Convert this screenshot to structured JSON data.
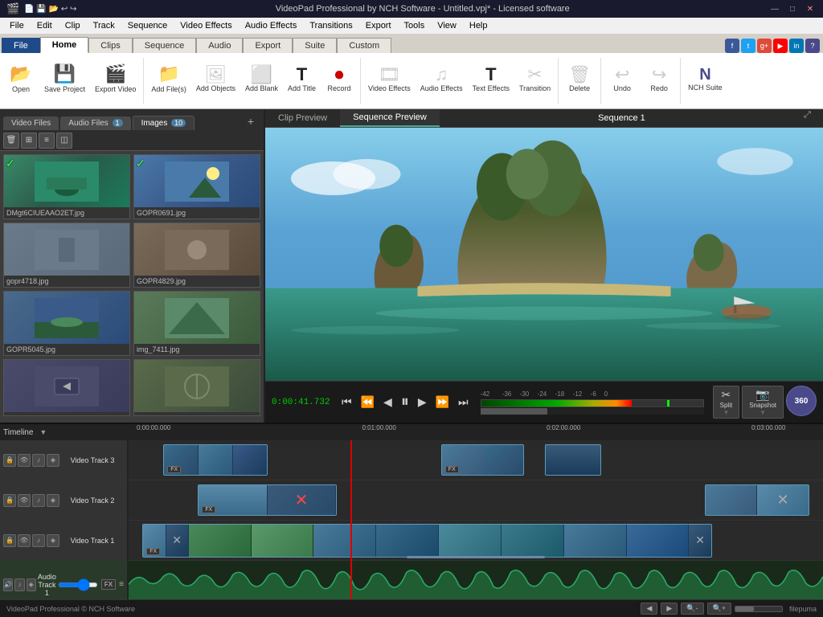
{
  "titlebar": {
    "title": "VideoPad Professional by NCH Software - Untitled.vpj* - Licensed software",
    "min": "—",
    "max": "□",
    "close": "✕"
  },
  "menubar": {
    "items": [
      "File",
      "Edit",
      "Clip",
      "Track",
      "Sequence",
      "Video Effects",
      "Audio Effects",
      "Transitions",
      "Export",
      "Tools",
      "View",
      "Help"
    ]
  },
  "ribbon_tabs": {
    "tabs": [
      "File",
      "Home",
      "Clips",
      "Sequence",
      "Audio",
      "Export",
      "Suite",
      "Custom"
    ]
  },
  "ribbon": {
    "buttons": [
      {
        "icon": "📂",
        "label": "Open"
      },
      {
        "icon": "💾",
        "label": "Save Project"
      },
      {
        "icon": "🎬",
        "label": "Export Video"
      },
      {
        "icon": "📁",
        "label": "Add File(s)"
      },
      {
        "icon": "➕",
        "label": "Add Objects"
      },
      {
        "icon": "⬜",
        "label": "Add Blank"
      },
      {
        "icon": "T",
        "label": "Add Title"
      },
      {
        "icon": "⏺",
        "label": "Record"
      },
      {
        "icon": "🎞",
        "label": "Video Effects"
      },
      {
        "icon": "♪",
        "label": "Audio Effects"
      },
      {
        "icon": "T",
        "label": "Text Effects"
      },
      {
        "icon": "✂",
        "label": "Transition"
      },
      {
        "icon": "🗑",
        "label": "Delete"
      },
      {
        "icon": "↩",
        "label": "Undo"
      },
      {
        "icon": "↪",
        "label": "Redo"
      },
      {
        "icon": "N",
        "label": "NCH Suite"
      }
    ]
  },
  "media_tabs": {
    "tabs": [
      {
        "label": "Video Files",
        "badge": ""
      },
      {
        "label": "Audio Files",
        "badge": "1"
      },
      {
        "label": "Images",
        "badge": "10"
      }
    ],
    "active": 2,
    "add_btn": "+"
  },
  "media_files": [
    {
      "label": "DMgt6CIUEAAO2ET.jpg",
      "has_check": true,
      "color1": "#3a8a6a",
      "color2": "#2a6a4a"
    },
    {
      "label": "GOPR0691.jpg",
      "has_check": true,
      "color1": "#4a7a9a",
      "color2": "#3a5a7a"
    },
    {
      "label": "gopr4718.jpg",
      "has_check": false,
      "color1": "#5a6a7a",
      "color2": "#4a5a6a"
    },
    {
      "label": "GOPR4829.jpg",
      "has_check": false,
      "color1": "#6a5a4a",
      "color2": "#5a4a3a"
    },
    {
      "label": "GOPR5045.jpg",
      "has_check": false,
      "color1": "#4a6a8a",
      "color2": "#3a5a7a"
    },
    {
      "label": "img_7411.jpg",
      "has_check": false,
      "color1": "#5a7a5a",
      "color2": "#4a6a4a"
    },
    {
      "label": "",
      "has_check": false,
      "color1": "#4a4a4a",
      "color2": "#3a3a3a"
    },
    {
      "label": "",
      "has_check": false,
      "color1": "#5a5a5a",
      "color2": "#4a4a4a"
    }
  ],
  "preview": {
    "clip_preview": "Clip Preview",
    "sequence_preview": "Sequence Preview",
    "sequence_title": "Sequence 1",
    "timecode": "0:00:41.732"
  },
  "transport": {
    "skip_start": "⏮",
    "prev_frame": "⏪",
    "step_back": "⏴",
    "play": "⏸",
    "step_fwd": "⏵",
    "next_frame": "⏩",
    "skip_end": "⏭",
    "split": "Split",
    "snapshot": "Snapshot",
    "vr360": "360"
  },
  "timeline": {
    "label": "Timeline",
    "tracks": [
      {
        "name": "Video Track 3",
        "type": "video"
      },
      {
        "name": "Video Track 2",
        "type": "video"
      },
      {
        "name": "Video Track 1",
        "type": "video"
      },
      {
        "name": "Audio Track 1",
        "type": "audio"
      }
    ],
    "ruler_marks": [
      "0:00:00.000",
      "0:01:00.000",
      "0:02:00.000",
      "0:03:00.000"
    ]
  },
  "statusbar": {
    "left": "VideoPad Professional © NCH Software",
    "right": "filepuma"
  }
}
